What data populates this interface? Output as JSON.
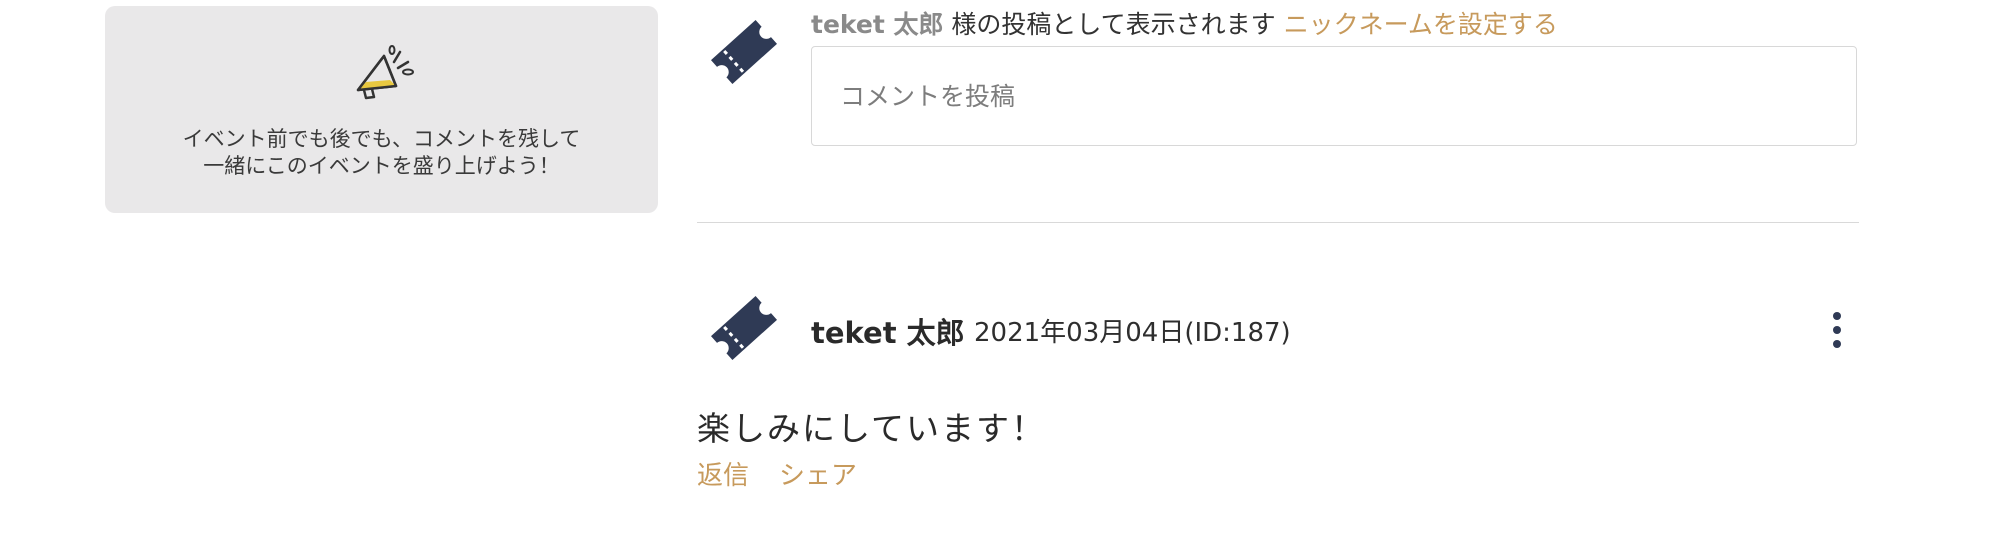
{
  "info_card": {
    "icon": "megaphone-icon",
    "lines": [
      "イベント前でも後でも、コメントを残して",
      "一緒にこのイベントを盛り上げよう！"
    ]
  },
  "composer": {
    "avatar_icon": "ticket-icon",
    "user_name": "teket 太郎",
    "posting_as_suffix": " 様の投稿として表示されます ",
    "set_nickname_label": "ニックネームを設定する",
    "placeholder": "コメントを投稿",
    "value": ""
  },
  "comments": [
    {
      "avatar_icon": "ticket-icon",
      "author": "teket 太郎",
      "date": "2021年03月04日(ID:187)",
      "body": "楽しみにしています！",
      "actions": [
        "返信",
        "シェア"
      ]
    }
  ],
  "colors": {
    "accent": "#c79a5c",
    "ticket": "#2f3a55",
    "card_bg": "#e9e8e9"
  }
}
